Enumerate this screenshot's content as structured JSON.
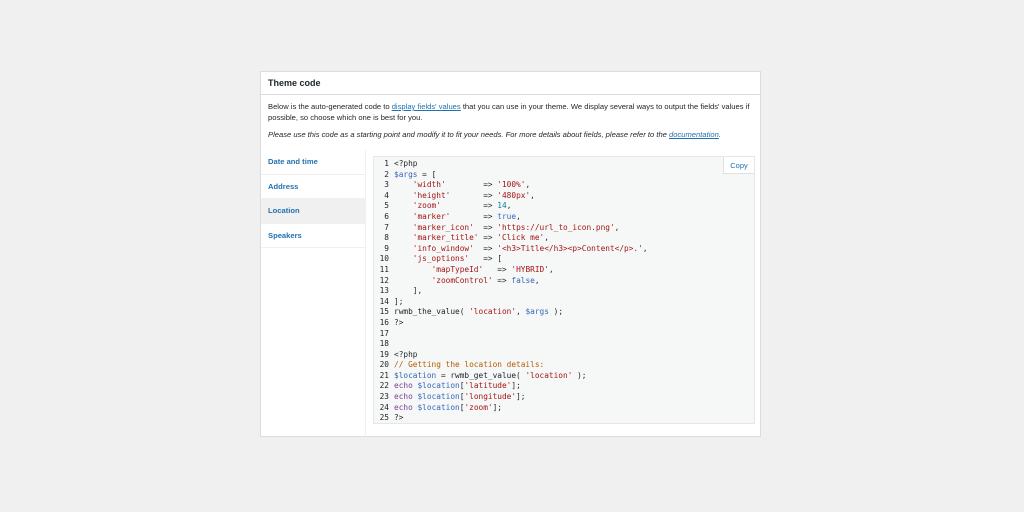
{
  "panel": {
    "title": "Theme code",
    "intro": {
      "p1_before": "Below is the auto-generated code to ",
      "p1_link": "display fields' values",
      "p1_after": " that you can use in your theme. We display several ways to output the fields' values if possible, so choose which one is best for you.",
      "p2_before": "Please use this code as a starting point and modify it to fit your needs. For more details about fields, please refer to the ",
      "p2_link": "documentation",
      "p2_after": "."
    }
  },
  "tabs": [
    {
      "label": "Date and time",
      "active": false
    },
    {
      "label": "Address",
      "active": false
    },
    {
      "label": "Location",
      "active": true
    },
    {
      "label": "Speakers",
      "active": false
    }
  ],
  "copy_label": "Copy",
  "code_lines": [
    {
      "n": "1",
      "tokens": [
        {
          "t": "<?php",
          "c": "src"
        }
      ]
    },
    {
      "n": "2",
      "tokens": [
        {
          "t": "$args",
          "c": "var"
        },
        {
          "t": " = [",
          "c": "src"
        }
      ]
    },
    {
      "n": "3",
      "tokens": [
        {
          "t": "    ",
          "c": "src"
        },
        {
          "t": "'width'",
          "c": "str"
        },
        {
          "t": "        => ",
          "c": "src"
        },
        {
          "t": "'100%'",
          "c": "str"
        },
        {
          "t": ",",
          "c": "src"
        }
      ]
    },
    {
      "n": "4",
      "tokens": [
        {
          "t": "    ",
          "c": "src"
        },
        {
          "t": "'height'",
          "c": "str"
        },
        {
          "t": "       => ",
          "c": "src"
        },
        {
          "t": "'480px'",
          "c": "str"
        },
        {
          "t": ",",
          "c": "src"
        }
      ]
    },
    {
      "n": "5",
      "tokens": [
        {
          "t": "    ",
          "c": "src"
        },
        {
          "t": "'zoom'",
          "c": "str"
        },
        {
          "t": "         => ",
          "c": "src"
        },
        {
          "t": "14",
          "c": "num"
        },
        {
          "t": ",",
          "c": "src"
        }
      ]
    },
    {
      "n": "6",
      "tokens": [
        {
          "t": "    ",
          "c": "src"
        },
        {
          "t": "'marker'",
          "c": "str"
        },
        {
          "t": "       => ",
          "c": "src"
        },
        {
          "t": "true",
          "c": "bool"
        },
        {
          "t": ",",
          "c": "src"
        }
      ]
    },
    {
      "n": "7",
      "tokens": [
        {
          "t": "    ",
          "c": "src"
        },
        {
          "t": "'marker_icon'",
          "c": "str"
        },
        {
          "t": "  => ",
          "c": "src"
        },
        {
          "t": "'https://url_to_icon.png'",
          "c": "str"
        },
        {
          "t": ",",
          "c": "src"
        }
      ]
    },
    {
      "n": "8",
      "tokens": [
        {
          "t": "    ",
          "c": "src"
        },
        {
          "t": "'marker_title'",
          "c": "str"
        },
        {
          "t": " => ",
          "c": "src"
        },
        {
          "t": "'Click me'",
          "c": "str"
        },
        {
          "t": ",",
          "c": "src"
        }
      ]
    },
    {
      "n": "9",
      "tokens": [
        {
          "t": "    ",
          "c": "src"
        },
        {
          "t": "'info_window'",
          "c": "str"
        },
        {
          "t": "  => ",
          "c": "src"
        },
        {
          "t": "'<h3>Title</h3><p>Content</p>.'",
          "c": "str"
        },
        {
          "t": ",",
          "c": "src"
        }
      ]
    },
    {
      "n": "10",
      "tokens": [
        {
          "t": "    ",
          "c": "src"
        },
        {
          "t": "'js_options'",
          "c": "str"
        },
        {
          "t": "   => [",
          "c": "src"
        }
      ]
    },
    {
      "n": "11",
      "tokens": [
        {
          "t": "        ",
          "c": "src"
        },
        {
          "t": "'mapTypeId'",
          "c": "str"
        },
        {
          "t": "   => ",
          "c": "src"
        },
        {
          "t": "'HYBRID'",
          "c": "str"
        },
        {
          "t": ",",
          "c": "src"
        }
      ]
    },
    {
      "n": "12",
      "tokens": [
        {
          "t": "        ",
          "c": "src"
        },
        {
          "t": "'zoomControl'",
          "c": "str"
        },
        {
          "t": " => ",
          "c": "src"
        },
        {
          "t": "false",
          "c": "bool"
        },
        {
          "t": ",",
          "c": "src"
        }
      ]
    },
    {
      "n": "13",
      "tokens": [
        {
          "t": "    ],",
          "c": "src"
        }
      ]
    },
    {
      "n": "14",
      "tokens": [
        {
          "t": "];",
          "c": "src"
        }
      ]
    },
    {
      "n": "15",
      "tokens": [
        {
          "t": "rwmb_the_value( ",
          "c": "src"
        },
        {
          "t": "'location'",
          "c": "str"
        },
        {
          "t": ", ",
          "c": "src"
        },
        {
          "t": "$args",
          "c": "var"
        },
        {
          "t": " );",
          "c": "src"
        }
      ]
    },
    {
      "n": "16",
      "tokens": [
        {
          "t": "?>",
          "c": "src"
        }
      ]
    },
    {
      "n": "17",
      "tokens": []
    },
    {
      "n": "18",
      "tokens": []
    },
    {
      "n": "19",
      "tokens": [
        {
          "t": "<?php",
          "c": "src"
        }
      ]
    },
    {
      "n": "20",
      "tokens": [
        {
          "t": "// Getting the location details:",
          "c": "com"
        }
      ]
    },
    {
      "n": "21",
      "tokens": [
        {
          "t": "$location",
          "c": "var"
        },
        {
          "t": " = rwmb_get_value( ",
          "c": "src"
        },
        {
          "t": "'location'",
          "c": "str"
        },
        {
          "t": " );",
          "c": "src"
        }
      ]
    },
    {
      "n": "22",
      "tokens": [
        {
          "t": "echo",
          "c": "kw"
        },
        {
          "t": " ",
          "c": "src"
        },
        {
          "t": "$location",
          "c": "var"
        },
        {
          "t": "[",
          "c": "src"
        },
        {
          "t": "'latitude'",
          "c": "str"
        },
        {
          "t": "];",
          "c": "src"
        }
      ]
    },
    {
      "n": "23",
      "tokens": [
        {
          "t": "echo",
          "c": "kw"
        },
        {
          "t": " ",
          "c": "src"
        },
        {
          "t": "$location",
          "c": "var"
        },
        {
          "t": "[",
          "c": "src"
        },
        {
          "t": "'longitude'",
          "c": "str"
        },
        {
          "t": "];",
          "c": "src"
        }
      ]
    },
    {
      "n": "24",
      "tokens": [
        {
          "t": "echo",
          "c": "kw"
        },
        {
          "t": " ",
          "c": "src"
        },
        {
          "t": "$location",
          "c": "var"
        },
        {
          "t": "[",
          "c": "src"
        },
        {
          "t": "'zoom'",
          "c": "str"
        },
        {
          "t": "];",
          "c": "src"
        }
      ]
    },
    {
      "n": "25",
      "tokens": [
        {
          "t": "?>",
          "c": "src"
        }
      ]
    }
  ]
}
